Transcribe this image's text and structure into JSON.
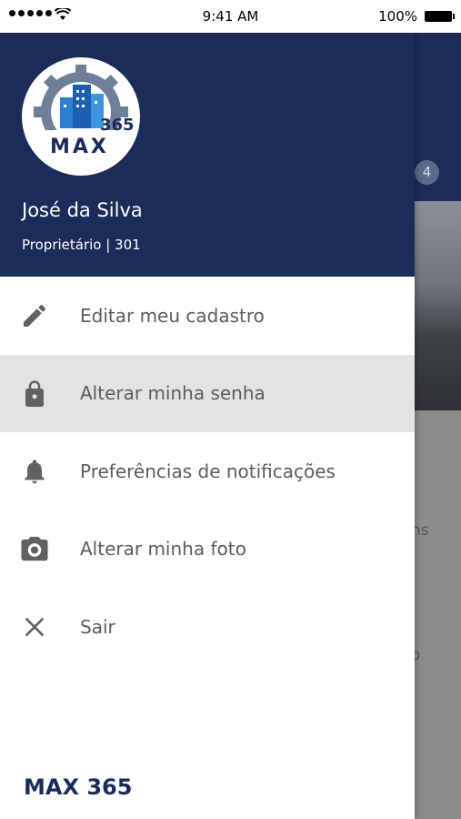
{
  "status_bar": {
    "time": "9:41 AM",
    "battery": "100%"
  },
  "drawer": {
    "logo": {
      "text": "MAX",
      "number": "365"
    },
    "user": {
      "name": "José da Silva",
      "role": "Proprietário | 301"
    },
    "menu": [
      {
        "label": "Editar meu cadastro",
        "icon": "pencil-icon",
        "active": false
      },
      {
        "label": "Alterar minha senha",
        "icon": "lock-icon",
        "active": true
      },
      {
        "label": "Preferências de notificações",
        "icon": "bell-icon",
        "active": false
      },
      {
        "label": "Alterar minha foto",
        "icon": "camera-icon",
        "active": false
      },
      {
        "label": "Sair",
        "icon": "close-icon",
        "active": false
      }
    ],
    "footer_brand": "MAX 365"
  },
  "background": {
    "badge": "4",
    "fragment_1": "ns",
    "fragment_2": "o"
  },
  "colors": {
    "primary": "#1b2c5a",
    "active_row": "#e3e3e3",
    "label": "#5c5c5c"
  }
}
